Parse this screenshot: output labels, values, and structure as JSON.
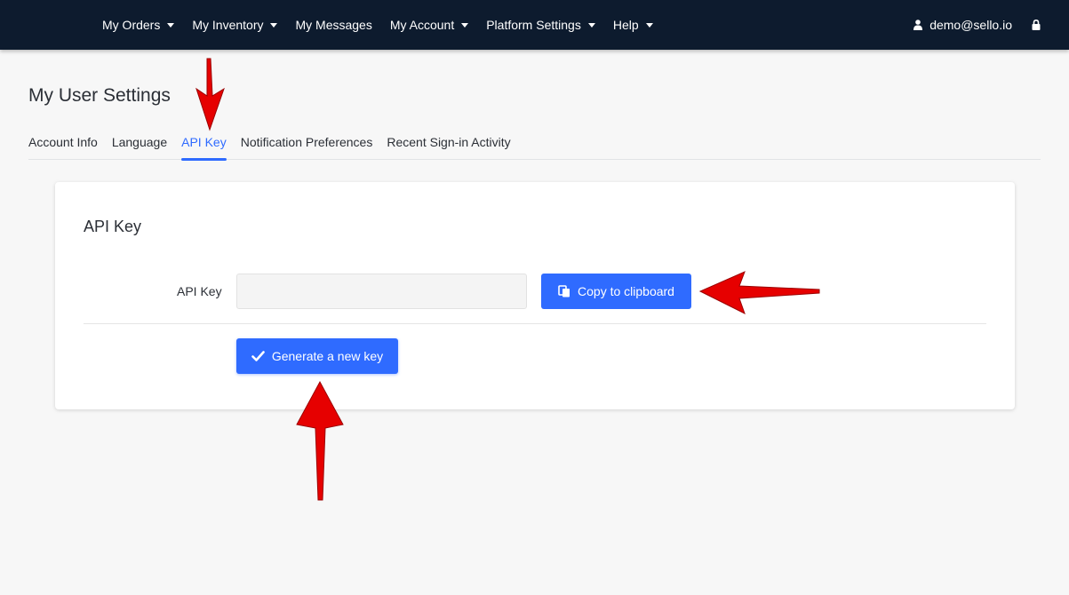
{
  "navbar": {
    "items": [
      {
        "label": "My Orders",
        "has_dropdown": true
      },
      {
        "label": "My Inventory",
        "has_dropdown": true
      },
      {
        "label": "My Messages",
        "has_dropdown": false
      },
      {
        "label": "My Account",
        "has_dropdown": true
      },
      {
        "label": "Platform Settings",
        "has_dropdown": true
      },
      {
        "label": "Help",
        "has_dropdown": true
      }
    ],
    "user_email": "demo@sello.io",
    "user_icon": "user-icon",
    "lock_icon": "lock-icon"
  },
  "page": {
    "title": "My User Settings",
    "tabs": [
      {
        "label": "Account Info",
        "active": false
      },
      {
        "label": "Language",
        "active": false
      },
      {
        "label": "API Key",
        "active": true
      },
      {
        "label": "Notification Preferences",
        "active": false
      },
      {
        "label": "Recent Sign-in Activity",
        "active": false
      }
    ]
  },
  "card": {
    "title": "API Key",
    "field_label": "API Key",
    "api_key_value": "",
    "copy_button_label": "Copy to clipboard",
    "copy_icon": "clipboard-icon",
    "generate_button_label": "Generate a new key",
    "generate_icon": "checkmark-icon"
  },
  "colors": {
    "navbar_bg": "#0d1b2e",
    "accent": "#2f6bff",
    "annotation_arrow": "#e60000"
  }
}
